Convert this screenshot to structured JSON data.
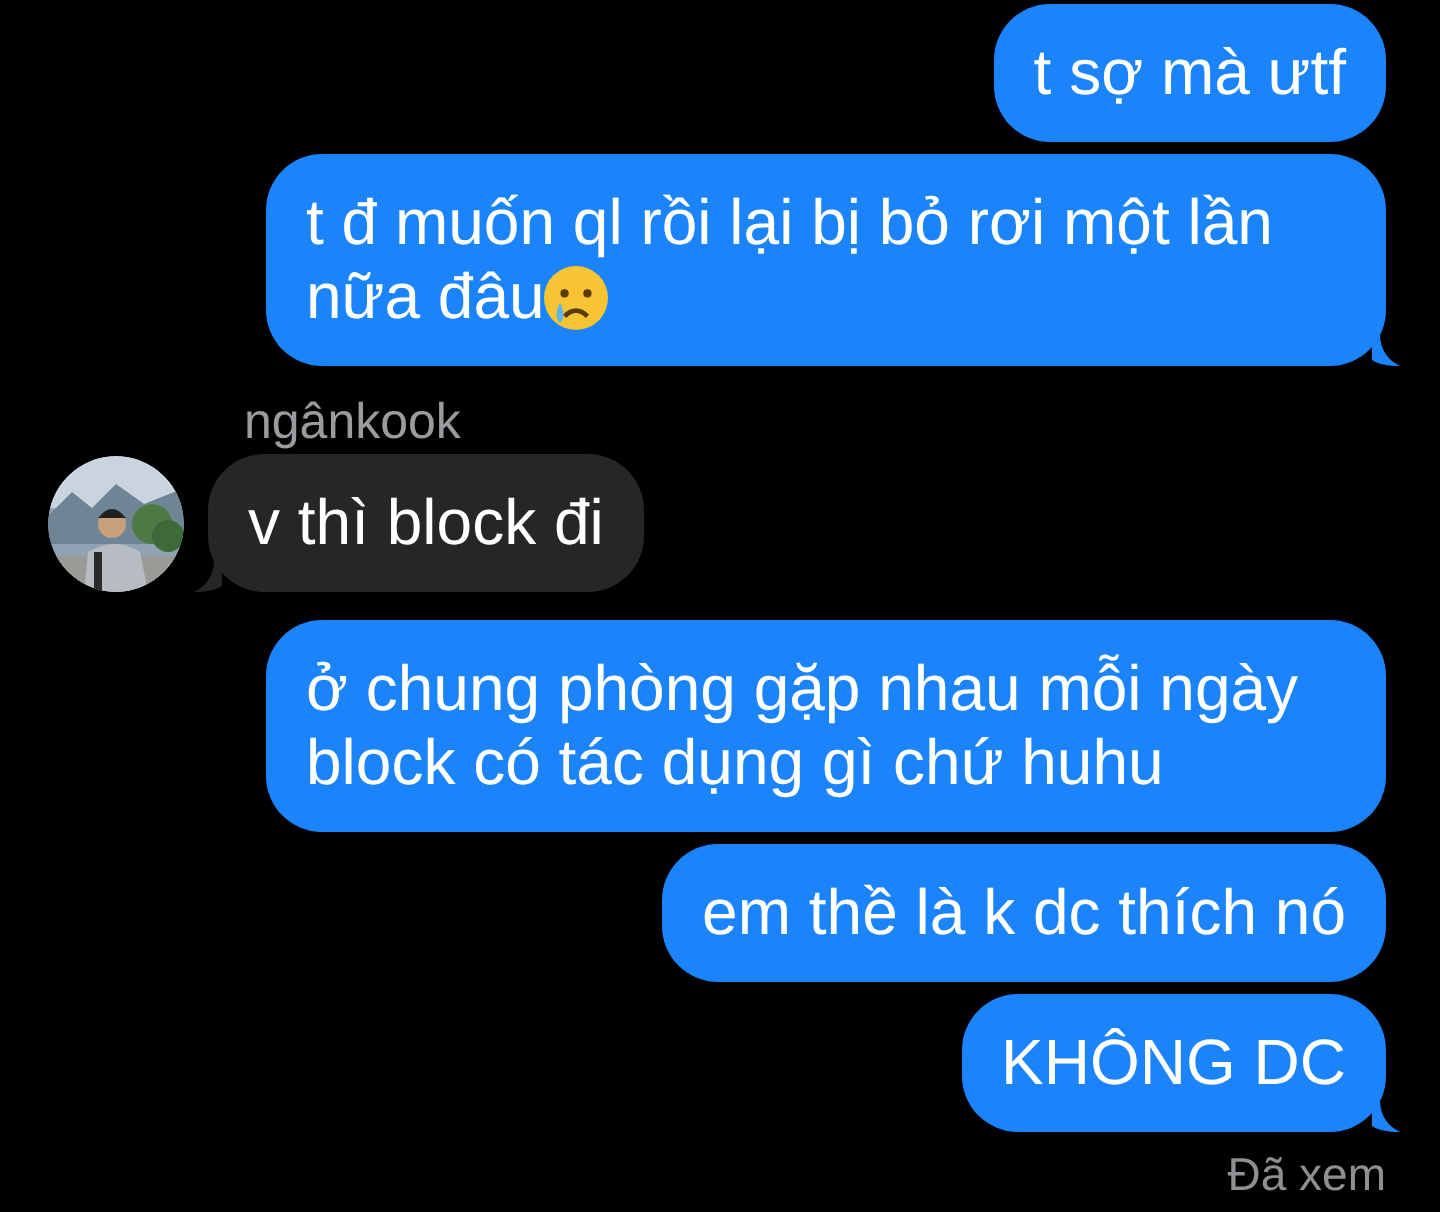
{
  "messages": [
    {
      "kind": "outgoing",
      "text": "t sợ mà ưtf",
      "tail": false
    },
    {
      "kind": "outgoing",
      "text": "t đ muốn ql rồi lại bị bỏ rơi một lần nữa đâu",
      "has_emoji": true,
      "tail": true
    },
    {
      "kind": "incoming",
      "sender": "ngânkook",
      "text": "v thì block đi",
      "tail": true
    },
    {
      "kind": "outgoing",
      "text": "ở chung phòng gặp nhau mỗi ngày block có tác dụng gì chứ huhu",
      "tail": false
    },
    {
      "kind": "outgoing",
      "text": "em thề là k dc thích nó",
      "tail": false
    },
    {
      "kind": "outgoing",
      "text": "KHÔNG DC",
      "tail": true
    }
  ],
  "read_receipt": "Đã xem"
}
